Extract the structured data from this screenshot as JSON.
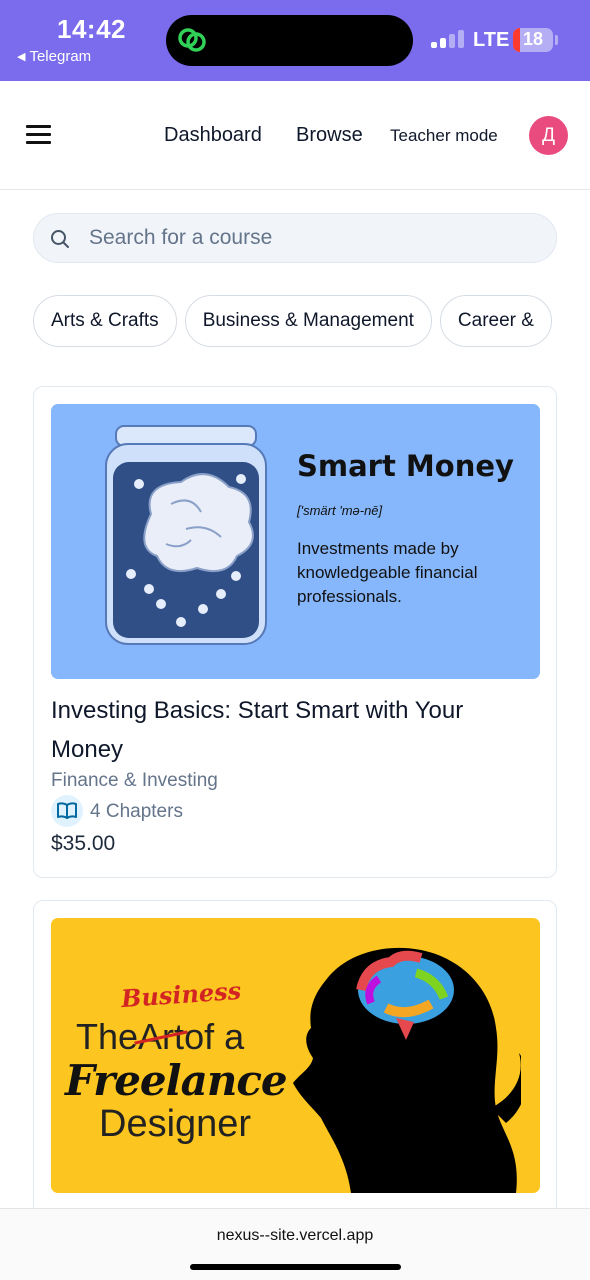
{
  "status_bar": {
    "time": "14:42",
    "back_app": "Telegram",
    "network": "LTE",
    "battery_level": "18",
    "battery_color": "#ff3b30",
    "background": "#7a6cec"
  },
  "nav": {
    "menu_icon": "hamburger-icon",
    "links": [
      "Dashboard",
      "Browse"
    ],
    "teacher_mode": "Teacher mode",
    "avatar_initial": "Д",
    "avatar_color": "#e94b7f"
  },
  "search": {
    "placeholder": "Search for a course",
    "value": "",
    "icon": "search-icon"
  },
  "categories": [
    "Arts & Crafts",
    "Business & Management",
    "Career & "
  ],
  "courses": [
    {
      "title": "Investing Basics: Start Smart with Your Money",
      "category": "Finance & Investing",
      "chapters": "4 Chapters",
      "price": "$35.00",
      "thumbnail": {
        "heading": "Smart Money",
        "phonetic": "['smärt 'mə-nē]",
        "definition": "Investments made by knowledgeable financial professionals.",
        "background": "#86b6fb"
      }
    },
    {
      "thumbnail": {
        "word_business": "Business",
        "word_the": "The",
        "word_art": "Art",
        "word_of_a": "of a",
        "word_freelance": "Freelance",
        "word_designer": "Designer",
        "background": "#fcc51f"
      }
    }
  ],
  "browser": {
    "url": "nexus--site.vercel.app"
  }
}
